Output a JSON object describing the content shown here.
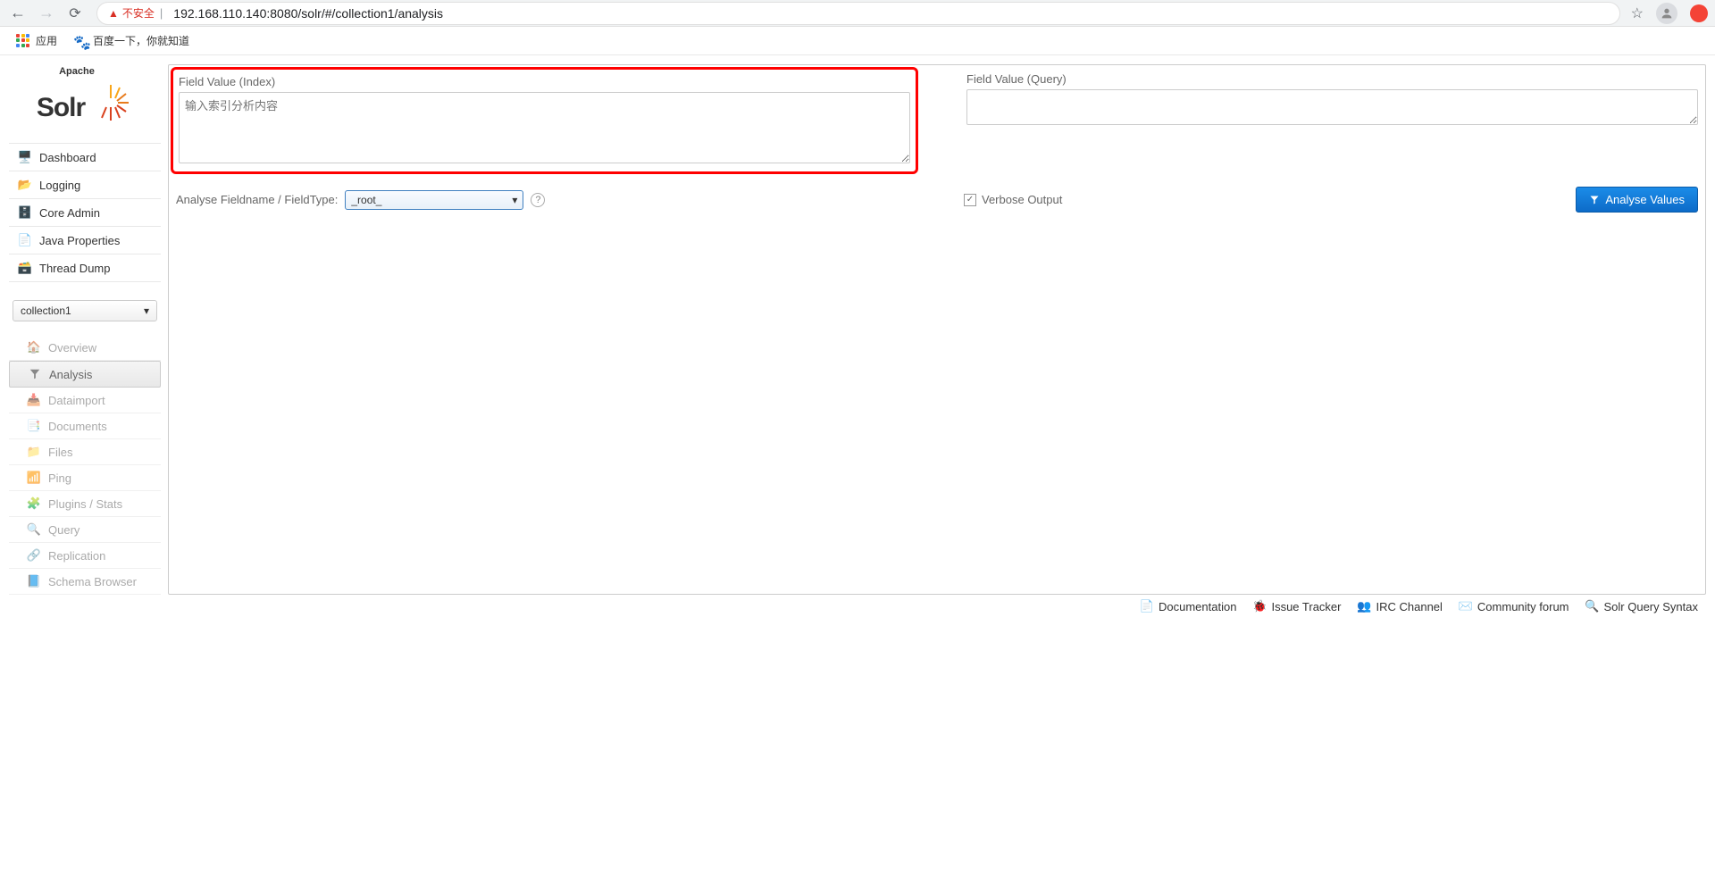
{
  "browser": {
    "insecure_label": "不安全",
    "url": "192.168.110.140:8080/solr/#/collection1/analysis"
  },
  "bookmarks": {
    "apps": "应用",
    "baidu": "百度一下，你就知道"
  },
  "logo": {
    "apache": "Apache",
    "name": "Solr"
  },
  "nav": {
    "dashboard": "Dashboard",
    "logging": "Logging",
    "core_admin": "Core Admin",
    "java_properties": "Java Properties",
    "thread_dump": "Thread Dump"
  },
  "core": {
    "selected": "collection1"
  },
  "sub_nav": {
    "overview": "Overview",
    "analysis": "Analysis",
    "dataimport": "Dataimport",
    "documents": "Documents",
    "files": "Files",
    "ping": "Ping",
    "plugins": "Plugins / Stats",
    "query": "Query",
    "replication": "Replication",
    "schema_browser": "Schema Browser"
  },
  "analysis": {
    "index_label": "Field Value (Index)",
    "index_placeholder": "输入索引分析内容",
    "query_label": "Field Value (Query)",
    "fieldname_label": "Analyse Fieldname / FieldType:",
    "fieldtype_selected": "_root_",
    "verbose_label": "Verbose Output",
    "button_label": "Analyse Values"
  },
  "footer": {
    "documentation": "Documentation",
    "issue_tracker": "Issue Tracker",
    "irc": "IRC Channel",
    "forum": "Community forum",
    "query_syntax": "Solr Query Syntax"
  }
}
